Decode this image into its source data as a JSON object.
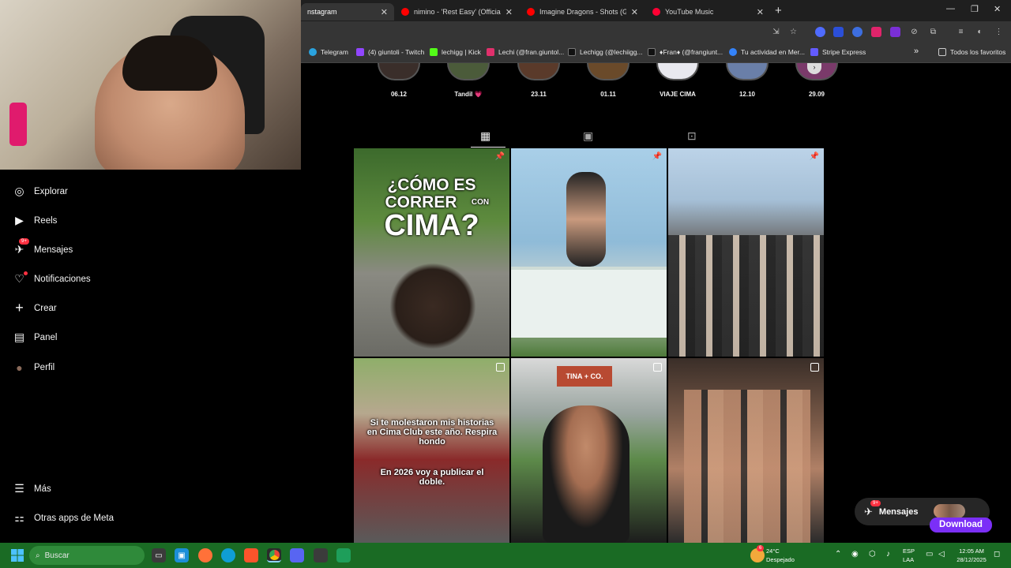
{
  "browser": {
    "tabs": [
      {
        "title": "nstagram",
        "color": "#e1306c",
        "active": true
      },
      {
        "title": "nimino - 'Rest Easy' (Official M",
        "color": "#ff0000",
        "active": false
      },
      {
        "title": "Imagine Dragons - Shots (Grav",
        "color": "#ff0000",
        "active": false
      },
      {
        "title": "YouTube Music",
        "color": "#ff0033",
        "active": false
      }
    ],
    "new_tab": "+",
    "window_controls": [
      "—",
      "❐",
      "✕"
    ],
    "bookmarks": [
      {
        "label": "Telegram",
        "color": "#2aa3df"
      },
      {
        "label": "(4) giuntoli - Twitch",
        "color": "#9146ff"
      },
      {
        "label": "lechigg | Kick",
        "color": "#53fc18"
      },
      {
        "label": "Lechi (@fran.giuntol...",
        "color": "#e1306c"
      },
      {
        "label": "Lechigg (@lechiigg...",
        "color": "#111111"
      },
      {
        "label": "♦Fran♦ (@frangiunt...",
        "color": "#111111"
      },
      {
        "label": "Tu actividad en Mer...",
        "color": "#3483fa"
      },
      {
        "label": "Stripe Express",
        "color": "#635bff"
      }
    ],
    "bookmarks_overflow": "»",
    "all_favorites": "Todos los favoritos"
  },
  "sidebar": {
    "items": [
      {
        "label": "Explorar",
        "icon": "compass-icon",
        "glyph": "◎"
      },
      {
        "label": "Reels",
        "icon": "reels-icon",
        "glyph": "▶"
      },
      {
        "label": "Mensajes",
        "icon": "messenger-icon",
        "glyph": "✈",
        "badge": "9+"
      },
      {
        "label": "Notificaciones",
        "icon": "heart-icon",
        "glyph": "♡"
      },
      {
        "label": "Crear",
        "icon": "plus-icon",
        "glyph": "+"
      },
      {
        "label": "Panel",
        "icon": "chart-icon",
        "glyph": "▤"
      },
      {
        "label": "Perfil",
        "icon": "avatar-icon",
        "glyph": "●"
      }
    ],
    "bottom_items": [
      {
        "label": "Más",
        "icon": "menu-icon",
        "glyph": "☰"
      },
      {
        "label": "Otras apps de Meta",
        "icon": "meta-apps-icon",
        "glyph": "⚏"
      }
    ]
  },
  "stories": [
    {
      "label": "06.12"
    },
    {
      "label": "Tandil 💗"
    },
    {
      "label": "23.11"
    },
    {
      "label": "01.11"
    },
    {
      "label": "VIAJE CIMA"
    },
    {
      "label": "12.10"
    },
    {
      "label": "29.09"
    }
  ],
  "profile_tabs": [
    "posts-grid",
    "reels",
    "tagged"
  ],
  "posts": [
    {
      "kind": "pinned",
      "title_line1": "¿CÓMO ES",
      "title_line2": "CORRER",
      "title_con": "CON",
      "title_line3": "CIMA?"
    },
    {
      "kind": "pinned"
    },
    {
      "kind": "pinned"
    },
    {
      "kind": "reel",
      "overlay_text": "Si te molestaron mis historias en Cima Club este año. Respira hondo",
      "overlay_text2": "En 2026 voy a publicar el doble."
    },
    {
      "kind": "reel",
      "sign": "TINA + CO."
    },
    {
      "kind": "reel"
    }
  ],
  "messages_float": {
    "label": "Mensajes",
    "badge": "9+"
  },
  "download_button": "Download",
  "taskbar": {
    "search_placeholder": "Buscar",
    "weather_temp": "24°C",
    "weather_desc": "Despejado",
    "weather_badge": "6",
    "lang1": "ESP",
    "lang2": "LAA",
    "time": "12:05 AM",
    "date": "28/12/2025"
  }
}
